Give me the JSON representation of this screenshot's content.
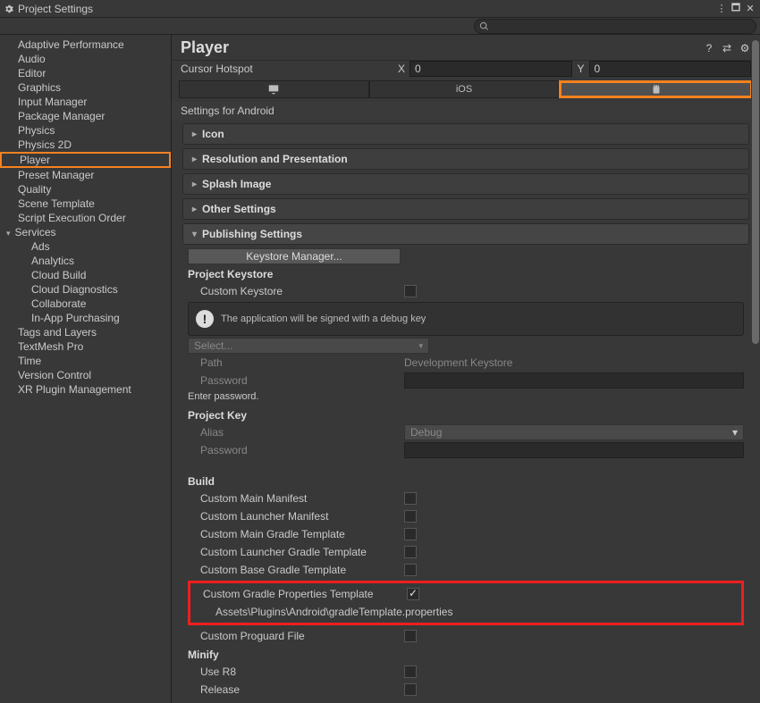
{
  "window": {
    "title": "Project Settings"
  },
  "sidebar": {
    "items": [
      "Adaptive Performance",
      "Audio",
      "Editor",
      "Graphics",
      "Input Manager",
      "Package Manager",
      "Physics",
      "Physics 2D",
      "Player",
      "Preset Manager",
      "Quality",
      "Scene Template",
      "Script Execution Order"
    ],
    "services_label": "Services",
    "services": [
      "Ads",
      "Analytics",
      "Cloud Build",
      "Cloud Diagnostics",
      "Collaborate",
      "In-App Purchasing"
    ],
    "items2": [
      "Tags and Layers",
      "TextMesh Pro",
      "Time",
      "Version Control",
      "XR Plugin Management"
    ]
  },
  "header": {
    "title": "Player"
  },
  "cursor": {
    "label": "Cursor Hotspot",
    "xlabel": "X",
    "x": "0",
    "ylabel": "Y",
    "y": "0"
  },
  "platforms": {
    "ios": "iOS"
  },
  "settings_for": "Settings for Android",
  "foldouts": {
    "icon": "Icon",
    "res": "Resolution and Presentation",
    "splash": "Splash Image",
    "other": "Other Settings",
    "publish": "Publishing Settings"
  },
  "publish": {
    "keystore_btn": "Keystore Manager...",
    "proj_keystore": "Project Keystore",
    "custom_keystore": "Custom Keystore",
    "info": "The application will be signed with a debug key",
    "select": "Select...",
    "path": "Path",
    "path_val": "Development Keystore",
    "password": "Password",
    "enter_pw": "Enter password.",
    "proj_key": "Project Key",
    "alias": "Alias",
    "alias_val": "Debug",
    "build": "Build",
    "b1": "Custom Main Manifest",
    "b2": "Custom Launcher Manifest",
    "b3": "Custom Main Gradle Template",
    "b4": "Custom Launcher Gradle Template",
    "b5": "Custom Base Gradle Template",
    "b6": "Custom Gradle Properties Template",
    "b6_path": "Assets\\Plugins\\Android\\gradleTemplate.properties",
    "b7": "Custom Proguard File",
    "minify": "Minify",
    "m1": "Use R8",
    "m2": "Release"
  }
}
